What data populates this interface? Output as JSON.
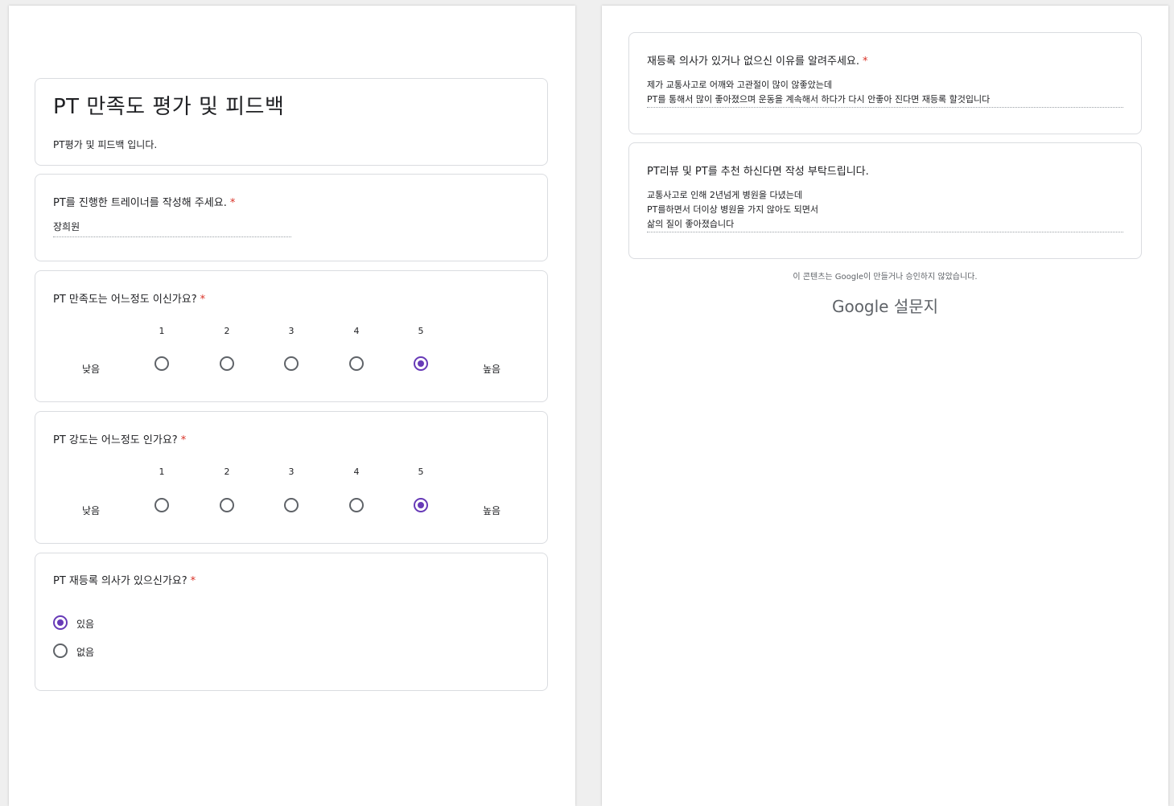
{
  "form": {
    "title": "PT 만족도 평가 및 피드백",
    "description": "PT평가 및 피드백 입니다.",
    "required_mark": "*"
  },
  "questions": {
    "trainer": {
      "title": "PT를 진행한 트레이너를 작성해 주세요.",
      "answer": "장희원"
    },
    "satisfaction": {
      "title": "PT 만족도는 어느정도 이신가요?",
      "scale": [
        "1",
        "2",
        "3",
        "4",
        "5"
      ],
      "low_label": "낮음",
      "high_label": "높음",
      "selected": 5
    },
    "intensity": {
      "title": "PT 강도는 어느정도 인가요?",
      "scale": [
        "1",
        "2",
        "3",
        "4",
        "5"
      ],
      "low_label": "낮음",
      "high_label": "높음",
      "selected": 5
    },
    "reregister": {
      "title": "PT 재등록 의사가 있으신가요?",
      "options": [
        "있음",
        "없음"
      ],
      "selected": "있음"
    },
    "reason": {
      "title": "재등록 의사가 있거나 없으신 이유를 알려주세요.",
      "answer_lines": [
        "제가 교통사고로 어깨와 고관절이 많이 않좋았는데",
        "PT를 통해서 많이 좋아졌으며 운동을 계속해서 하다가 다시 안좋아 진다면 재등록 할것입니다"
      ]
    },
    "review": {
      "title": "PT리뷰 및 PT를 추천 하신다면 작성 부탁드립니다.",
      "answer_lines": [
        "교통사고로 인해 2년넘게 병원을 다녔는데",
        "PT를하면서 더이상 병원을 가지 않아도 되면서",
        "삶의 질이 좋아졌습니다"
      ]
    }
  },
  "footer": {
    "note": "이 콘텐츠는 Google이 만들거나 승인하지 않았습니다.",
    "brand_google": "Google",
    "brand_forms": "설문지"
  },
  "colors": {
    "accent": "#673ab7",
    "required": "#d93025"
  }
}
